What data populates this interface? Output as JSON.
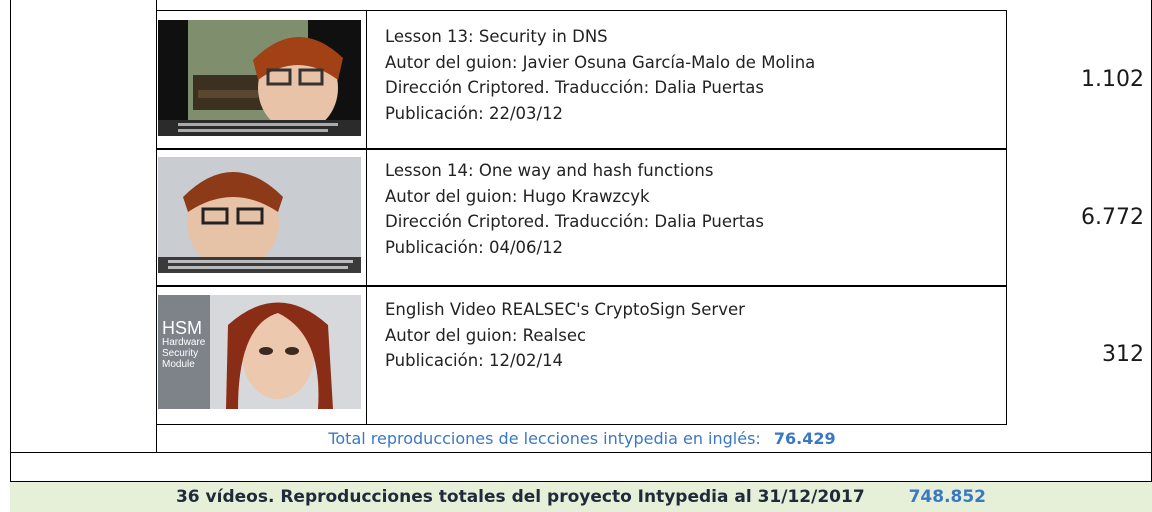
{
  "lessons": [
    {
      "title": "Lesson 13: Security in DNS",
      "author": "Autor del guion: Javier Osuna García-Malo de Molina",
      "direction": "Dirección Criptored. Traducción: Dalia Puertas",
      "published": "Publicación: 22/03/12",
      "views": "1.102"
    },
    {
      "title": "Lesson 14: One way and hash functions",
      "author": "Autor del guion: Hugo Krawzcyk",
      "direction": "Dirección Criptored. Traducción: Dalia Puertas",
      "published": "Publicación: 04/06/12",
      "views": "6.772"
    },
    {
      "title": "English Video REALSEC's CryptoSign Server",
      "author": "Autor del guion: Realsec",
      "published": "Publicación: 12/02/14",
      "views": "312"
    }
  ],
  "thumb3_text": [
    "HSM",
    "Hardware",
    "Security",
    "Module"
  ],
  "total_english": {
    "label": "Total reproducciones de lecciones intypedia en inglés:",
    "value": "76.429"
  },
  "summary": {
    "label": "36 vídeos. Reproducciones totales del proyecto Intypedia al 31/12/2017",
    "value": "748.852"
  },
  "colors": {
    "link_blue": "#3a78c3",
    "summary_bg": "#e6efd8"
  }
}
